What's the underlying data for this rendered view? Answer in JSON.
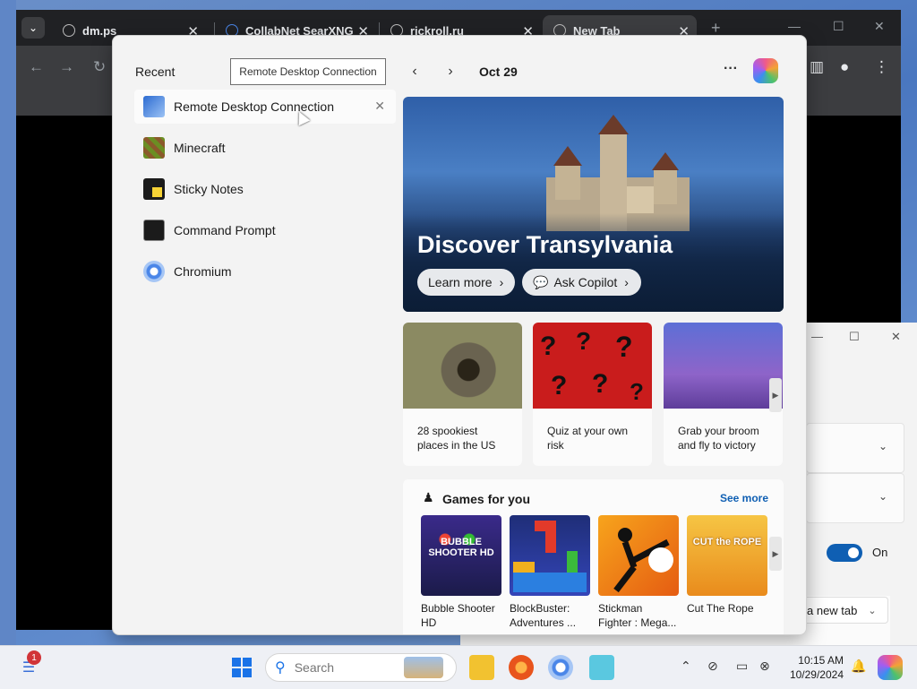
{
  "browser": {
    "tabs": [
      {
        "title": "dm.ps"
      },
      {
        "title": "CollabNet SearXNG"
      },
      {
        "title": "rickroll.ru"
      },
      {
        "title": "New Tab"
      }
    ]
  },
  "start_menu": {
    "recent_title": "Recent",
    "tooltip": "Remote Desktop Connection",
    "recent_items": [
      {
        "label": "Remote Desktop Connection",
        "icon": "rdc-icon"
      },
      {
        "label": "Minecraft",
        "icon": "minecraft-icon"
      },
      {
        "label": "Sticky Notes",
        "icon": "sticky-notes-icon"
      },
      {
        "label": "Command Prompt",
        "icon": "cmd-icon"
      },
      {
        "label": "Chromium",
        "icon": "chromium-icon"
      }
    ]
  },
  "feed": {
    "date": "Oct 29",
    "hero": {
      "title": "Discover Transylvania",
      "learn_more": "Learn more",
      "ask_copilot": "Ask Copilot"
    },
    "cards": [
      {
        "text": "28 spookiest places in the US"
      },
      {
        "text": "Quiz at your own risk"
      },
      {
        "text": "Grab your broom and fly to victory"
      }
    ],
    "games": {
      "title": "Games for you",
      "see_more": "See more",
      "items": [
        {
          "name": "Bubble Shooter HD",
          "art": "BUBBLE SHOOTER HD"
        },
        {
          "name": "BlockBuster: Adventures ...",
          "art": ""
        },
        {
          "name": "Stickman Fighter : Mega...",
          "art": ""
        },
        {
          "name": "Cut The Rope",
          "art": "CUT the ROPE"
        }
      ]
    }
  },
  "settings_window": {
    "toggle_label": "On",
    "select_value": "a new tab"
  },
  "taskbar": {
    "search_placeholder": "Search",
    "notification_count": "1",
    "time": "10:15 AM",
    "date": "10/29/2024"
  },
  "colors": {
    "accent": "#0f5fb3",
    "tab_bar": "#202124",
    "start_menu_bg": "#f3f3f3"
  }
}
